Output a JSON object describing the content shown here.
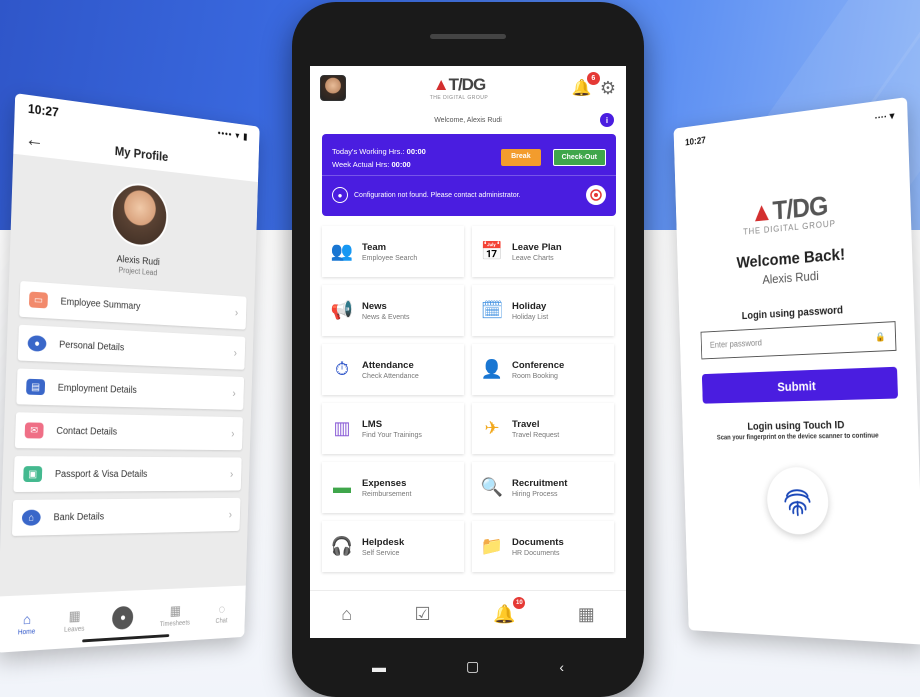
{
  "left": {
    "time": "10:27",
    "status_icons": "•••• ▾ ▮",
    "title": "My Profile",
    "name": "Alexis Rudi",
    "role": "Project Lead",
    "items": [
      {
        "label": "Employee Summary",
        "icon": "id-card-icon",
        "color": "#f28a6c"
      },
      {
        "label": "Personal Details",
        "icon": "person-icon",
        "color": "#3a67c9"
      },
      {
        "label": "Employment Details",
        "icon": "briefcase-icon",
        "color": "#3a67c9"
      },
      {
        "label": "Contact Details",
        "icon": "mail-icon",
        "color": "#ef6f86"
      },
      {
        "label": "Passport & Visa Details",
        "icon": "passport-icon",
        "color": "#44b98f"
      },
      {
        "label": "Bank Details",
        "icon": "bank-icon",
        "color": "#3a67c9"
      }
    ],
    "tabs": [
      "Home",
      "Leaves",
      "",
      "Timesheets",
      "Chat"
    ]
  },
  "center": {
    "brand": "T/DG",
    "brand_sub": "THE DIGITAL GROUP",
    "notif_count": "6",
    "welcome": "Welcome, Alexis Rudi",
    "working_label": "Today's Working Hrs.:",
    "working_value": "00:00",
    "actual_label": "Week Actual Hrs:",
    "actual_value": "00:00",
    "break_label": "Break",
    "checkout_label": "Check-Out",
    "config_msg": "Configuration not found. Please contact administrator.",
    "tiles": [
      {
        "title": "Team",
        "sub": "Employee Search",
        "icon": "team-icon"
      },
      {
        "title": "Leave Plan",
        "sub": "Leave Charts",
        "icon": "calendar-chart-icon"
      },
      {
        "title": "News",
        "sub": "News & Events",
        "icon": "megaphone-icon"
      },
      {
        "title": "Holiday",
        "sub": "Holiday List",
        "icon": "holiday-calendar-icon"
      },
      {
        "title": "Attendance",
        "sub": "Check Attendance",
        "icon": "attendance-icon"
      },
      {
        "title": "Conference",
        "sub": "Room Booking",
        "icon": "conference-icon"
      },
      {
        "title": "LMS",
        "sub": "Find Your Trainings",
        "icon": "training-icon"
      },
      {
        "title": "Travel",
        "sub": "Travel Request",
        "icon": "airplane-icon"
      },
      {
        "title": "Expenses",
        "sub": "Reimbursement",
        "icon": "wallet-icon"
      },
      {
        "title": "Recruitment",
        "sub": "Hiring Process",
        "icon": "search-person-icon"
      },
      {
        "title": "Helpdesk",
        "sub": "Self Service",
        "icon": "headset-icon"
      },
      {
        "title": "Documents",
        "sub": "HR Documents",
        "icon": "folder-icon"
      }
    ],
    "nav_badge": "10"
  },
  "right": {
    "time": "10:27",
    "brand": "T/DG",
    "brand_sub": "THE DIGITAL GROUP",
    "welcome": "Welcome Back!",
    "user": "Alexis Rudi",
    "login_pw": "Login using password",
    "placeholder": "Enter password",
    "submit": "Submit",
    "touch_title": "Login using Touch ID",
    "touch_sub": "Scan your fingerprint on the device scanner to continue"
  },
  "colors": {
    "accent": "#4a1de0",
    "break": "#f39c2d",
    "checkout": "#3fa64b",
    "logo_red": "#d32f2f"
  }
}
